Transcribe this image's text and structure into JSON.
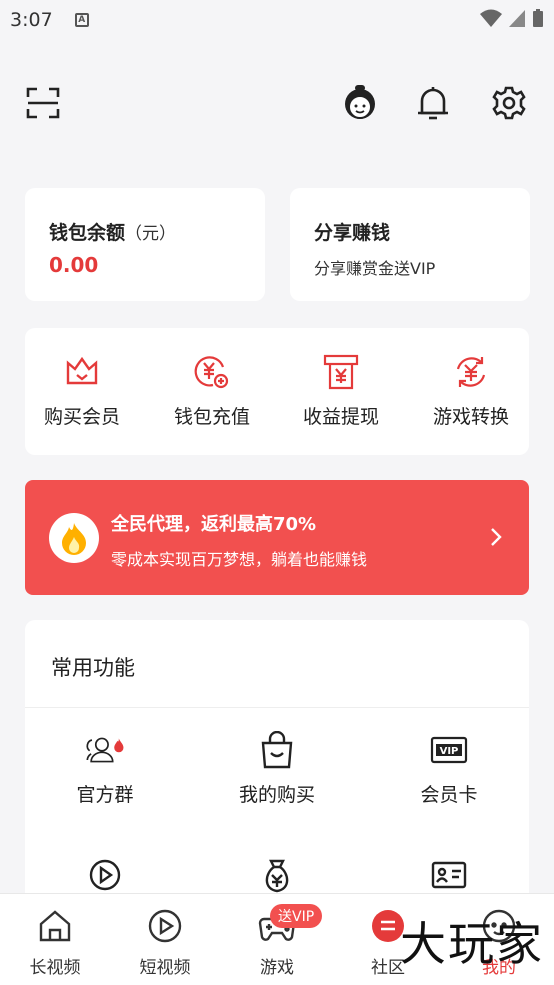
{
  "status_bar": {
    "time": "3:07",
    "a_icon": "A"
  },
  "topbar": {
    "icons": [
      "scan-icon",
      "customer-service-icon",
      "bell-icon",
      "gear-icon"
    ]
  },
  "wallet": {
    "title": "钱包余额",
    "unit": "（元）",
    "value": "0.00"
  },
  "share": {
    "title": "分享赚钱",
    "subtitle": "分享赚赏金送VIP"
  },
  "quick_actions": [
    {
      "label": "购买会员",
      "icon": "crown-icon"
    },
    {
      "label": "钱包充值",
      "icon": "yen-plus-icon"
    },
    {
      "label": "收益提现",
      "icon": "withdraw-icon"
    },
    {
      "label": "游戏转换",
      "icon": "exchange-icon"
    }
  ],
  "banner": {
    "title": "全民代理，返利最高70%",
    "subtitle": "零成本实现百万梦想，躺着也能赚钱"
  },
  "functions": {
    "title": "常用功能",
    "items": [
      {
        "label": "官方群",
        "icon": "group-fire-icon"
      },
      {
        "label": "我的购买",
        "icon": "shopping-bag-icon"
      },
      {
        "label": "会员卡",
        "icon": "vip-card-icon"
      }
    ],
    "second_row_icons": [
      "video-circle-icon",
      "money-bag-icon",
      "id-card-icon"
    ]
  },
  "tabbar": {
    "tabs": [
      {
        "label": "长视频",
        "icon": "house-icon"
      },
      {
        "label": "短视频",
        "icon": "play-circle-icon"
      },
      {
        "label": "游戏",
        "icon": "gamepad-icon"
      },
      {
        "label": "社区",
        "icon": "community-icon"
      },
      {
        "label": "我的",
        "icon": "profile-icon"
      }
    ],
    "vip_badge": "送VIP"
  },
  "watermark": "大玩家",
  "colors": {
    "accent": "#f2504f",
    "value_red": "#e43a3a",
    "background": "#f5f5f7"
  }
}
